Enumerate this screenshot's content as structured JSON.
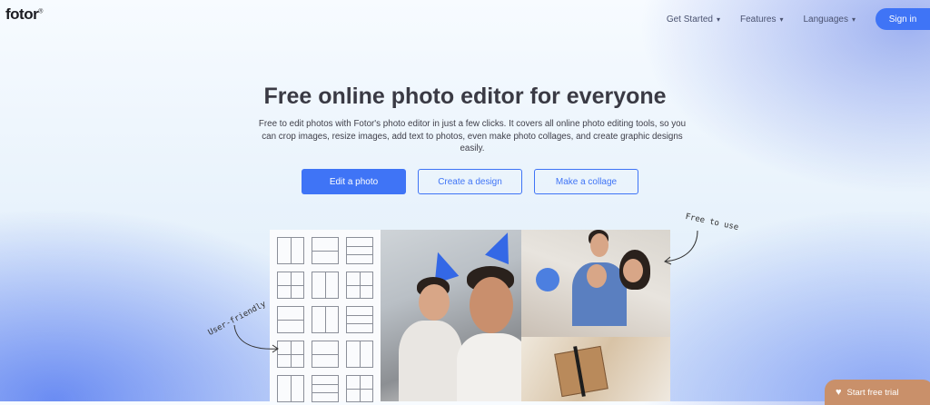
{
  "header": {
    "logo": "fotor",
    "logo_mark": "®",
    "nav": [
      {
        "label": "Get Started"
      },
      {
        "label": "Features"
      },
      {
        "label": "Languages"
      }
    ],
    "signin_label": "Sign in"
  },
  "hero": {
    "title": "Free online photo editor for everyone",
    "description": "Free to edit photos with Fotor's photo editor in just a few clicks. It covers all online photo editing tools, so you can crop images, resize images, add text to photos, even make photo collages, and create graphic designs easily.",
    "buttons": {
      "edit": "Edit a photo",
      "design": "Create a design",
      "collage": "Make a collage"
    }
  },
  "annotations": {
    "free": "Free to use",
    "user": "User-friendly"
  },
  "cta": {
    "label": "Start free trial",
    "icon": "heart-icon"
  },
  "colors": {
    "accent": "#3f74f6",
    "cta": "#c9906a"
  }
}
